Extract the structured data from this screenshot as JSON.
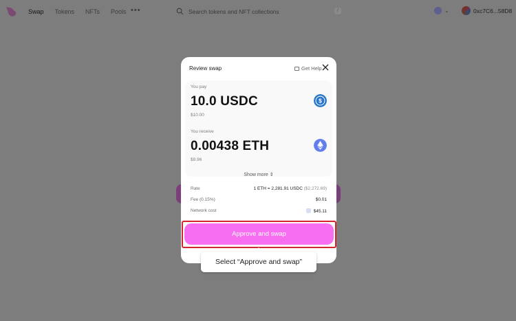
{
  "topbar": {
    "nav": [
      "Swap",
      "Tokens",
      "NFTs",
      "Pools"
    ],
    "more": "•••",
    "search_placeholder": "Search tokens and NFT collections",
    "search_shortcut": "/",
    "account_address": "0xc7C6...58D8"
  },
  "modal": {
    "title": "Review swap",
    "help_label": "Get Help",
    "pay": {
      "label": "You pay",
      "amount": "10.0 USDC",
      "fiat": "$10.00",
      "token_icon": "usdc-icon"
    },
    "receive": {
      "label": "You receive",
      "amount": "0.00438 ETH",
      "fiat": "$9.96",
      "token_icon": "eth-icon"
    },
    "show_more": "Show more ⇕",
    "details": {
      "rate_label": "Rate",
      "rate_value": "1 ETH = 2,281.91 USDC",
      "rate_fiat": "($2,272.69)",
      "fee_label": "Fee (0.15%)",
      "fee_value": "$0.01",
      "network_label": "Network cost",
      "network_value": "$45.11"
    },
    "approve_button": "Approve and swap"
  },
  "tooltip": {
    "text": "Select “Approve and swap”"
  },
  "colors": {
    "overlay_bg": "#7d7d7d",
    "approve_pink": "#f76ff0",
    "highlight_red": "#d5242b",
    "usdc_blue": "#2775ca",
    "eth_purple": "#627eea"
  }
}
